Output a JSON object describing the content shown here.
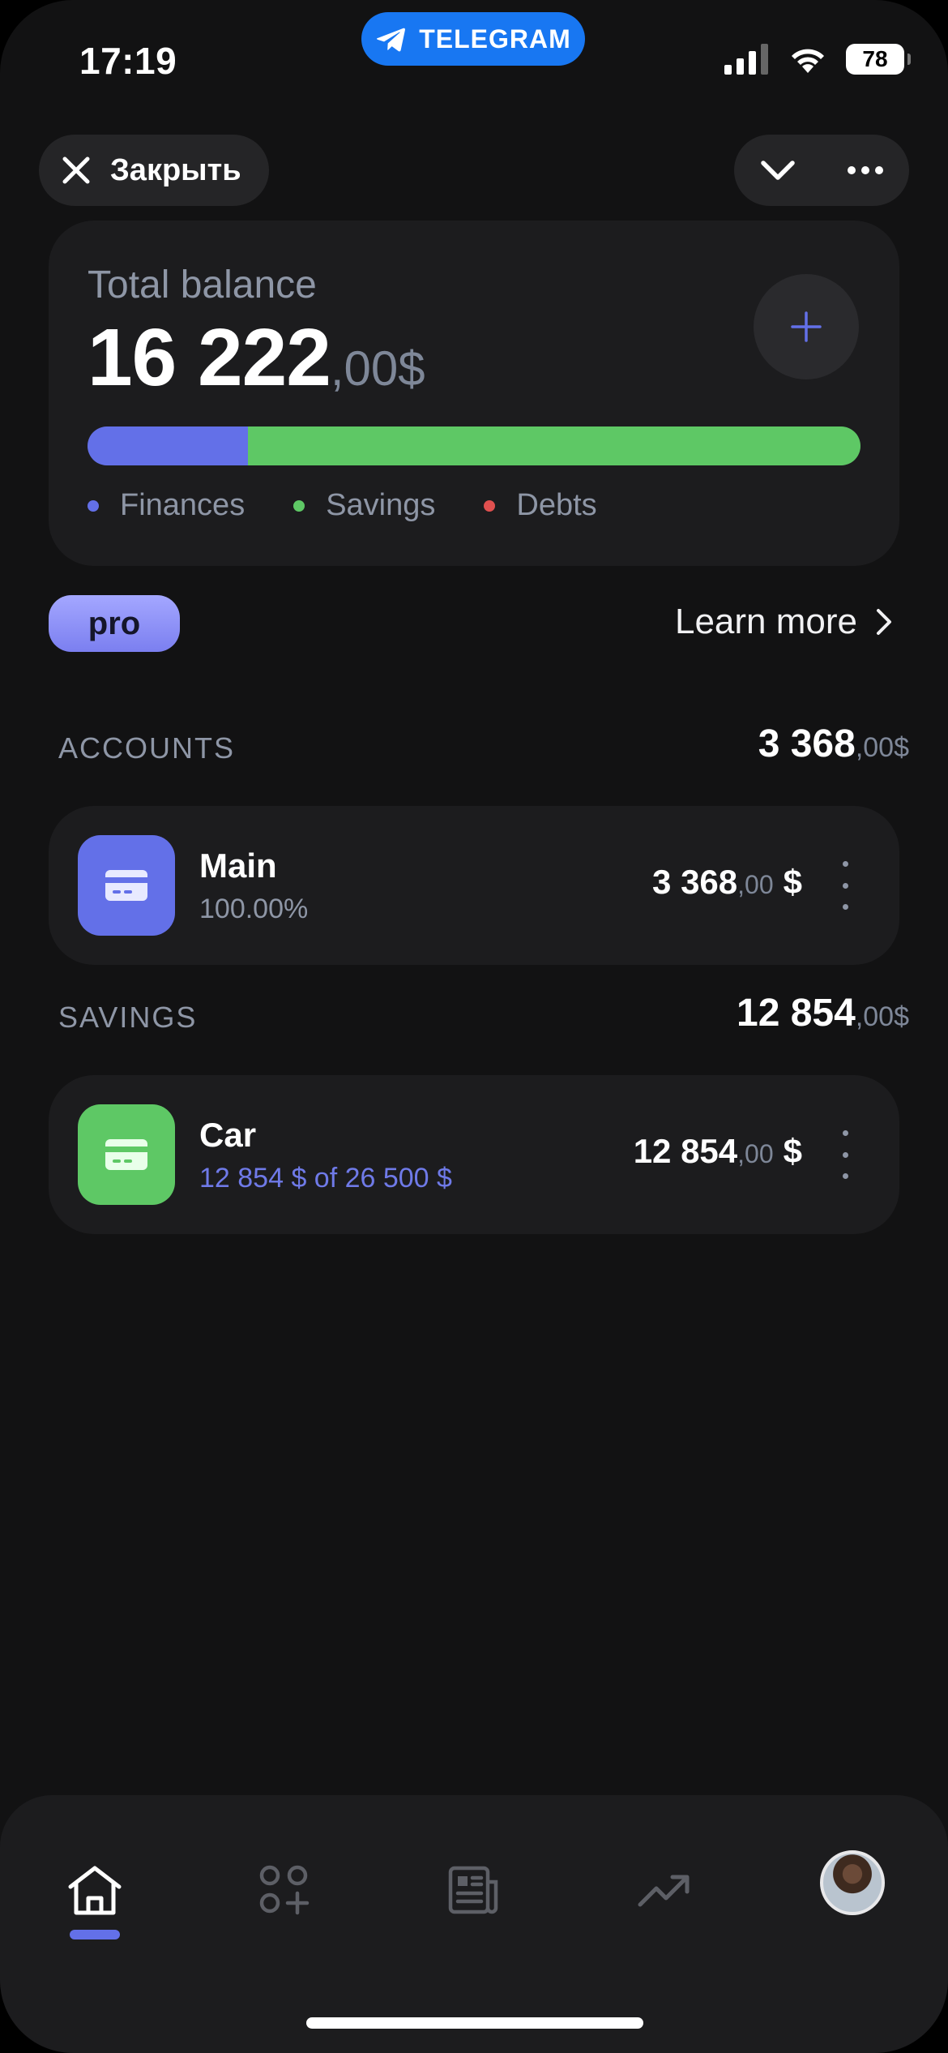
{
  "status_bar": {
    "time": "17:19",
    "telegram_label": "TELEGRAM",
    "battery": "78"
  },
  "top_bar": {
    "close_label": "Закрыть"
  },
  "balance": {
    "title": "Total balance",
    "amount_int": "16 222",
    "amount_dec": ",00$",
    "distribution": {
      "finances_fraction": 0.208,
      "savings_fraction": 0.792,
      "debts_fraction": 0.0
    },
    "legend": [
      {
        "label": "Finances",
        "color": "#6370e8"
      },
      {
        "label": "Savings",
        "color": "#5ec865"
      },
      {
        "label": "Debts",
        "color": "#e0504f"
      }
    ]
  },
  "promo": {
    "badge": "pro",
    "learn_more": "Learn more"
  },
  "accounts": {
    "label": "ACCOUNTS",
    "total_int": "3 368",
    "total_dec": ",00$",
    "items": [
      {
        "name": "Main",
        "subtitle": "100.00%",
        "amount_int": "3 368",
        "amount_dec": ",00",
        "currency": "$",
        "icon_color": "#6370e8"
      }
    ]
  },
  "savings": {
    "label": "SAVINGS",
    "total_int": "12 854",
    "total_dec": ",00$",
    "items": [
      {
        "name": "Car",
        "subtitle": "12 854 $ of 26 500 $",
        "amount_int": "12 854",
        "amount_dec": ",00",
        "currency": "$",
        "icon_color": "#5ec865"
      }
    ]
  },
  "bottom_nav": {
    "active": "home",
    "items": [
      "home-icon",
      "apps-add-icon",
      "news-icon",
      "trending-icon",
      "avatar"
    ]
  },
  "colors": {
    "accent": "#6370e8",
    "savings": "#5ec865",
    "debts": "#e0504f",
    "background": "#121213",
    "card": "#1c1c1e",
    "muted_text": "#8e96a6"
  }
}
